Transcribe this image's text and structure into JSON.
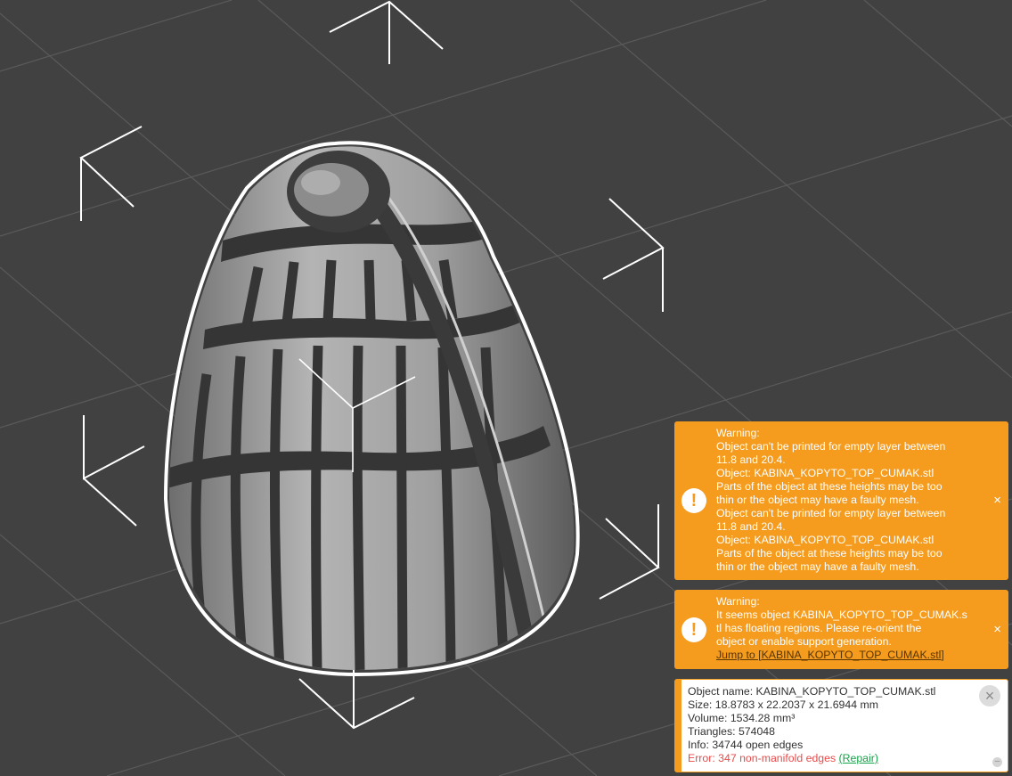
{
  "notifications": [
    {
      "title": "Warning:",
      "lines": [
        "Object can't be printed for empty layer between",
        "11.8 and 20.4.",
        "Object: KABINA_KOPYTO_TOP_CUMAK.stl",
        "Parts of the object at these heights may be too",
        "thin or the object may have a faulty mesh.",
        "Object can't be printed for empty layer between",
        "11.8 and 20.4.",
        "Object: KABINA_KOPYTO_TOP_CUMAK.stl",
        "Parts of the object at these heights may be too",
        "thin or the object may have a faulty mesh."
      ],
      "icon": "warning-icon",
      "close": "×"
    },
    {
      "title": "Warning:",
      "lines": [
        "It seems object KABINA_KOPYTO_TOP_CUMAK.s",
        "tl has floating regions. Please re-orient the",
        "object or enable support generation."
      ],
      "link": "Jump to [KABINA_KOPYTO_TOP_CUMAK.stl]",
      "icon": "warning-icon",
      "close": "×"
    }
  ],
  "object_info": {
    "name": "Object name: KABINA_KOPYTO_TOP_CUMAK.stl",
    "size": "Size: 18.8783 x 22.2037 x 21.6944 mm",
    "volume": "Volume: 1534.28 mm³",
    "triangles": "Triangles: 574048",
    "info": "Info: 34744 open edges",
    "error": "Error: 347 non-manifold edges",
    "repair": "(Repair)",
    "close": "×",
    "collapse": "–"
  },
  "colors": {
    "background": "#414141",
    "grid": "#5a5a5a",
    "warning": "#f59b1d",
    "model": "#9a9a9a",
    "selection_outline": "#ffffff",
    "error_text": "#e94a4a",
    "repair_link": "#15a34a"
  }
}
